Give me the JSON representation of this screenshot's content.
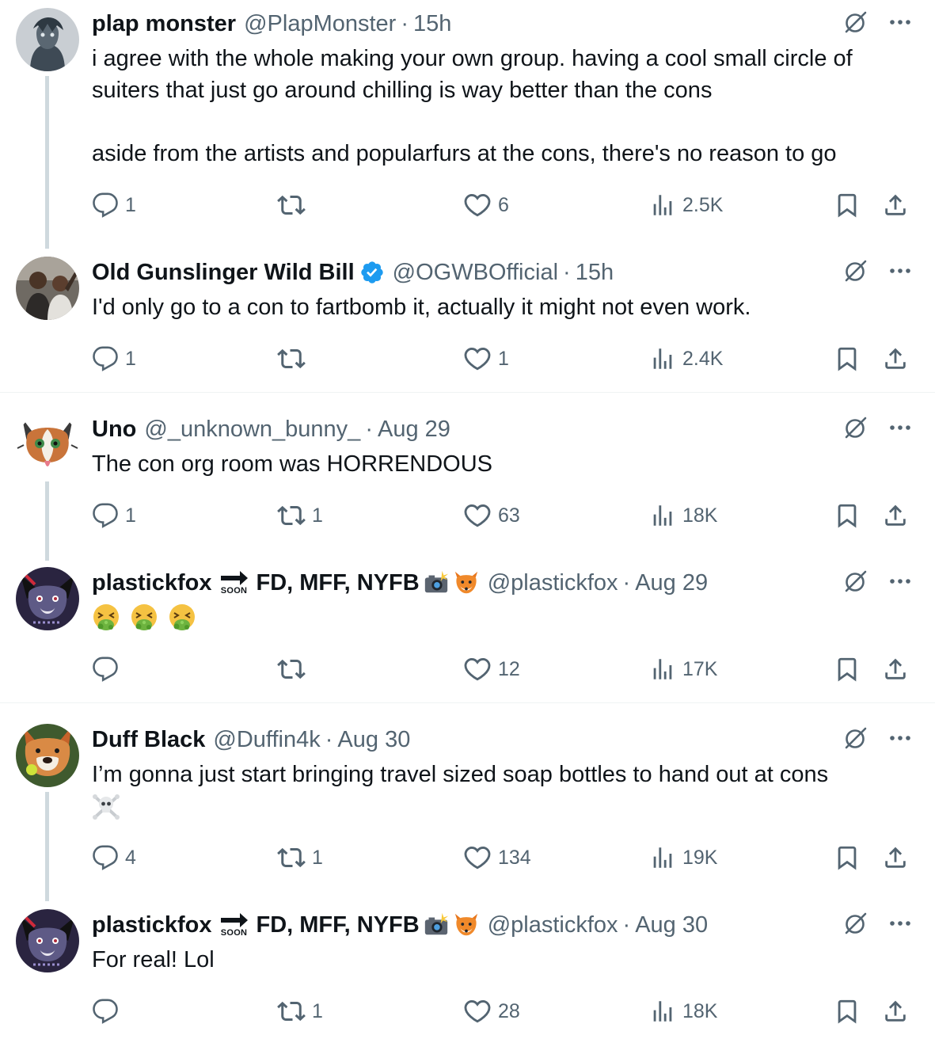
{
  "tweets": [
    {
      "name": "plap monster",
      "handle": "@PlapMonster",
      "dot": "·",
      "time": "15h",
      "text": "i agree with the whole making your own group. having a cool small circle of suiters that just go around chilling is way better than the cons\n\naside from the artists and popularfurs at the cons, there's no reason to go",
      "replies": "1",
      "reposts": "",
      "likes": "6",
      "views": "2.5K"
    },
    {
      "name": "Old Gunslinger Wild Bill",
      "handle": "@OGWBOfficial",
      "dot": "·",
      "time": "15h",
      "text": "I'd only go to a con to fartbomb it, actually it might not even work.",
      "replies": "1",
      "reposts": "",
      "likes": "1",
      "views": "2.4K"
    },
    {
      "name": "Uno",
      "handle": "@_unknown_bunny_",
      "dot": "·",
      "time": "Aug 29",
      "text": "The con org room was HORRENDOUS",
      "replies": "1",
      "reposts": "1",
      "likes": "63",
      "views": "18K"
    },
    {
      "name": "plastickfox",
      "name_suffix": "FD, MFF, NYFB",
      "soon_label": "SOON",
      "handle": "@plastickfox",
      "dot": "·",
      "time": "Aug 29",
      "replies": "",
      "reposts": "",
      "likes": "12",
      "views": "17K"
    },
    {
      "name": "Duff Black",
      "handle": "@Duffin4k",
      "dot": "·",
      "time": "Aug 30",
      "text": "I’m gonna just start bringing travel sized soap bottles to hand out at cons",
      "replies": "4",
      "reposts": "1",
      "likes": "134",
      "views": "19K"
    },
    {
      "name": "plastickfox",
      "name_suffix": "FD, MFF, NYFB",
      "soon_label": "SOON",
      "handle": "@plastickfox",
      "dot": "·",
      "time": "Aug 30",
      "text": "For real! Lol",
      "replies": "",
      "reposts": "1",
      "likes": "28",
      "views": "18K"
    }
  ],
  "colors": {
    "text": "#0f1419",
    "secondary": "#536471",
    "verified": "#1d9bf0",
    "thread_line": "#cfd9de",
    "divider": "#eff3f4"
  },
  "icons": [
    "reply-icon",
    "repost-icon",
    "like-icon",
    "views-icon",
    "bookmark-icon",
    "share-icon",
    "grok-icon",
    "more-icon",
    "verified-badge-icon",
    "camera-flash-emoji",
    "fox-emoji",
    "nauseated-face-emoji",
    "skull-crossbones-emoji",
    "soon-arrow-emoji"
  ]
}
